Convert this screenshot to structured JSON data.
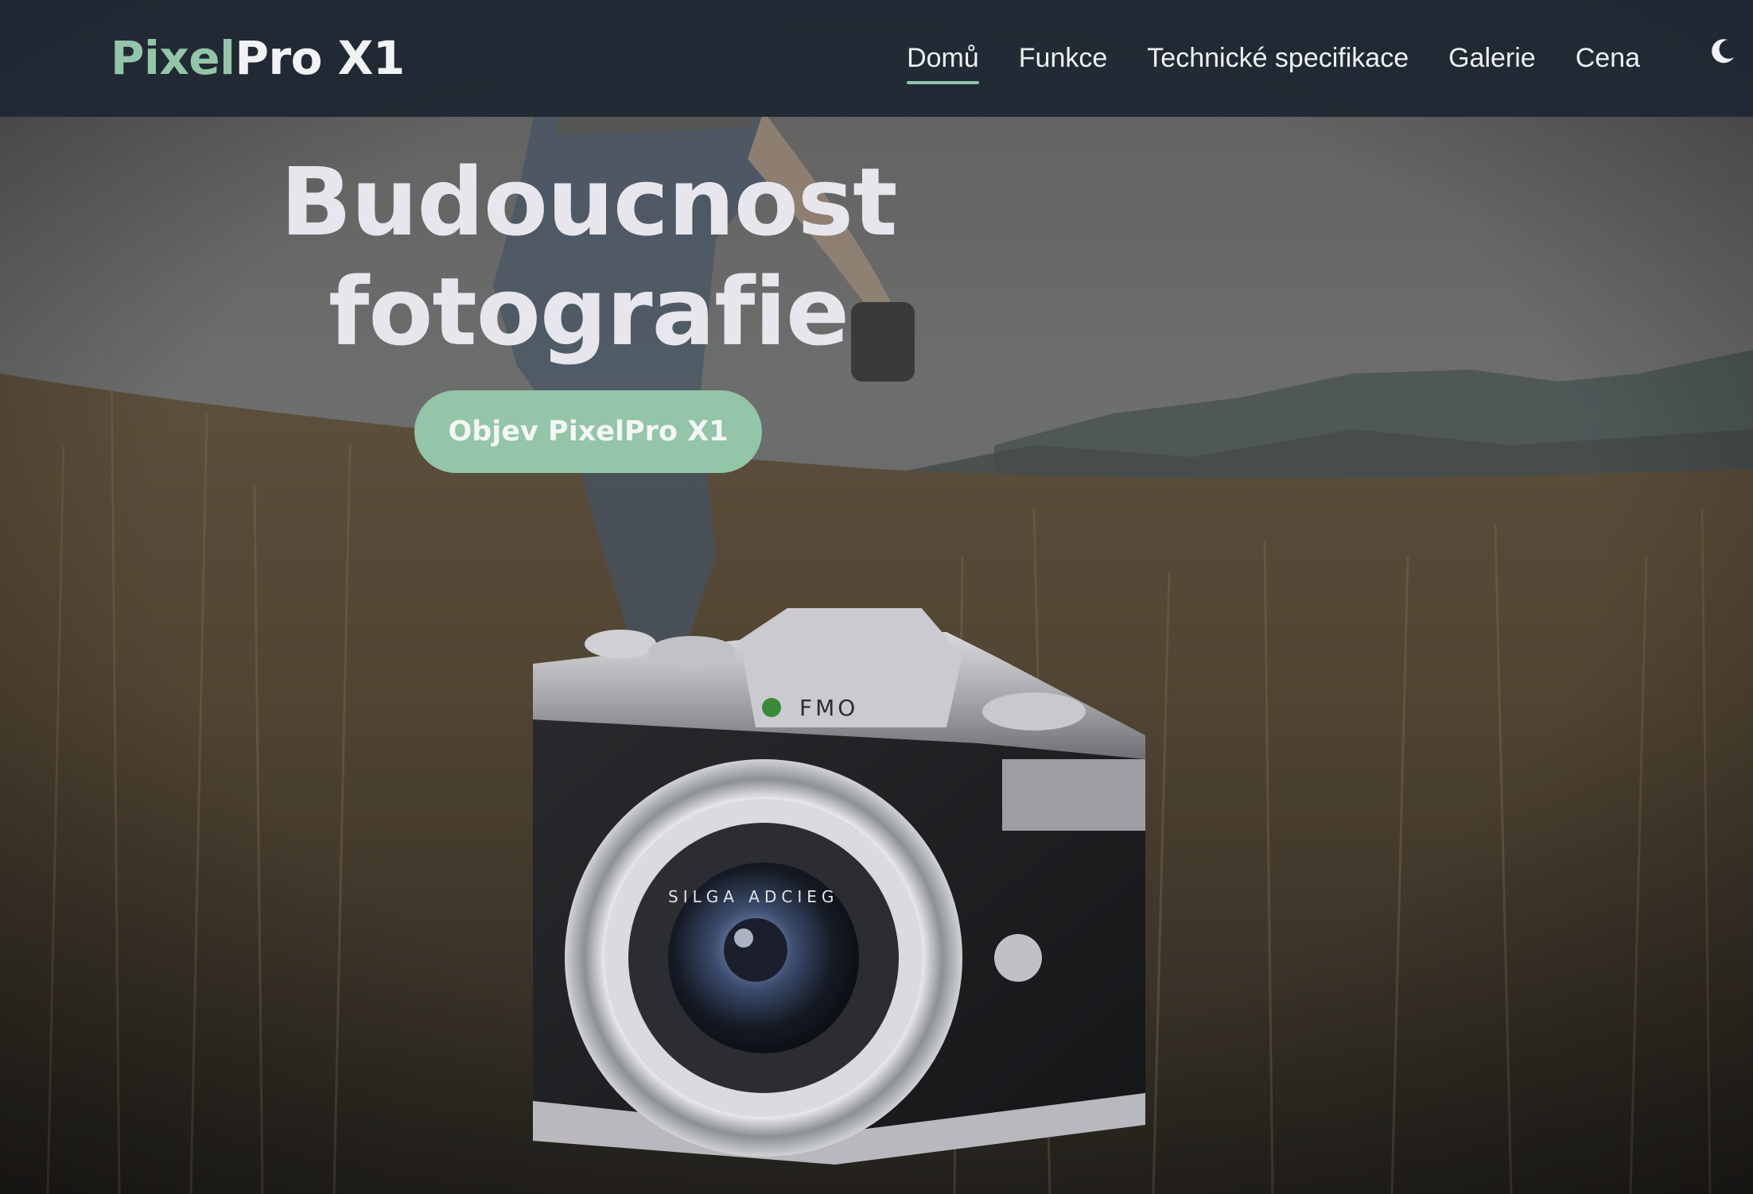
{
  "navbar": {
    "brand_accent": "Pixel",
    "brand_rest": "Pro X1",
    "links": [
      {
        "label": "Domů",
        "active": true
      },
      {
        "label": "Funkce",
        "active": false
      },
      {
        "label": "Technické specifikace",
        "active": false
      },
      {
        "label": "Galerie",
        "active": false
      },
      {
        "label": "Cena",
        "active": false
      }
    ],
    "theme_toggle_icon": "moon-icon"
  },
  "hero": {
    "title_line1": "Budoucnost",
    "title_line2": "fotografie",
    "cta_label": "Objev PixelPro X1",
    "camera_badge": "FMO",
    "lens_text": "SILGA ADCIEG"
  },
  "colors": {
    "navbar_bg": "#1f2933",
    "accent": "#93c5a8",
    "title_text": "#e7e6ec",
    "nav_text": "#eef0f2"
  }
}
